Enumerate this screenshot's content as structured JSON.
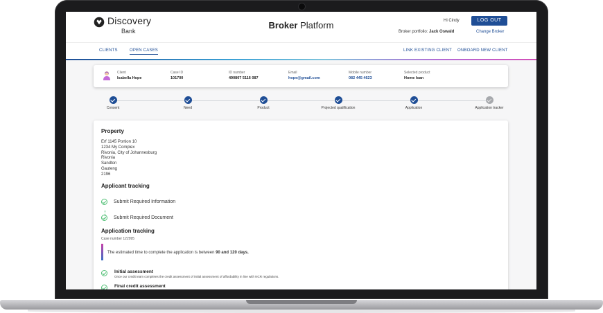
{
  "header": {
    "brand_name": "Discovery",
    "brand_sub": "Bank",
    "platform_bold": "Broker",
    "platform_rest": "Platform",
    "greeting": "Hi Cindy",
    "logout_label": "LOG OUT",
    "portfolio_label": "Broker portfolio:",
    "portfolio_name": "Jack Oswald",
    "change_broker_label": "Change Broker"
  },
  "nav": {
    "clients": "CLIENTS",
    "open_cases": "OPEN CASES",
    "link_existing": "LINK EXISTING CLIENT",
    "onboard_new": "ONBOARD NEW CLIENT"
  },
  "client_card": {
    "client_label": "Client",
    "client_value": "Isabella Hope",
    "case_id_label": "Case ID",
    "case_id_value": "101700",
    "id_number_label": "ID number",
    "id_number_value": "490807 5116 087",
    "email_label": "Email",
    "email_value": "hope@gmail.com",
    "mobile_label": "Mobile number",
    "mobile_value": "082 445 4623",
    "product_label": "Selected product",
    "product_value": "Home loan"
  },
  "steps": [
    "Consent",
    "Need",
    "Product",
    "Projected qualification",
    "Application",
    "Application tracker"
  ],
  "property": {
    "title": "Property",
    "address_lines": [
      "Erf 1145 Portion 10",
      "1234 My Complex",
      "Rivonia, City of Johannesburg",
      "Rivonia",
      "Sandton",
      "Gauteng",
      "2196"
    ]
  },
  "applicant_tracking": {
    "title": "Applicant tracking",
    "items": [
      "Submit Required Information",
      "Submit Required Document"
    ]
  },
  "application_tracking": {
    "title": "Application tracking",
    "case_number": "Case number 122995",
    "estimate_prefix": "The estimated time to complete the application is between",
    "estimate_value": "90 and 120 days.",
    "items": [
      {
        "title": "Initial assessment",
        "desc": "Once our credit team completes the credit assessment of initial assessment of affordability in line with NCR regulations."
      },
      {
        "title": "Final credit assessment",
        "desc": ""
      }
    ]
  },
  "colors": {
    "brand_blue": "#1f4e96",
    "success_green": "#4fbf74",
    "pending_grey": "#a7a9ad"
  }
}
